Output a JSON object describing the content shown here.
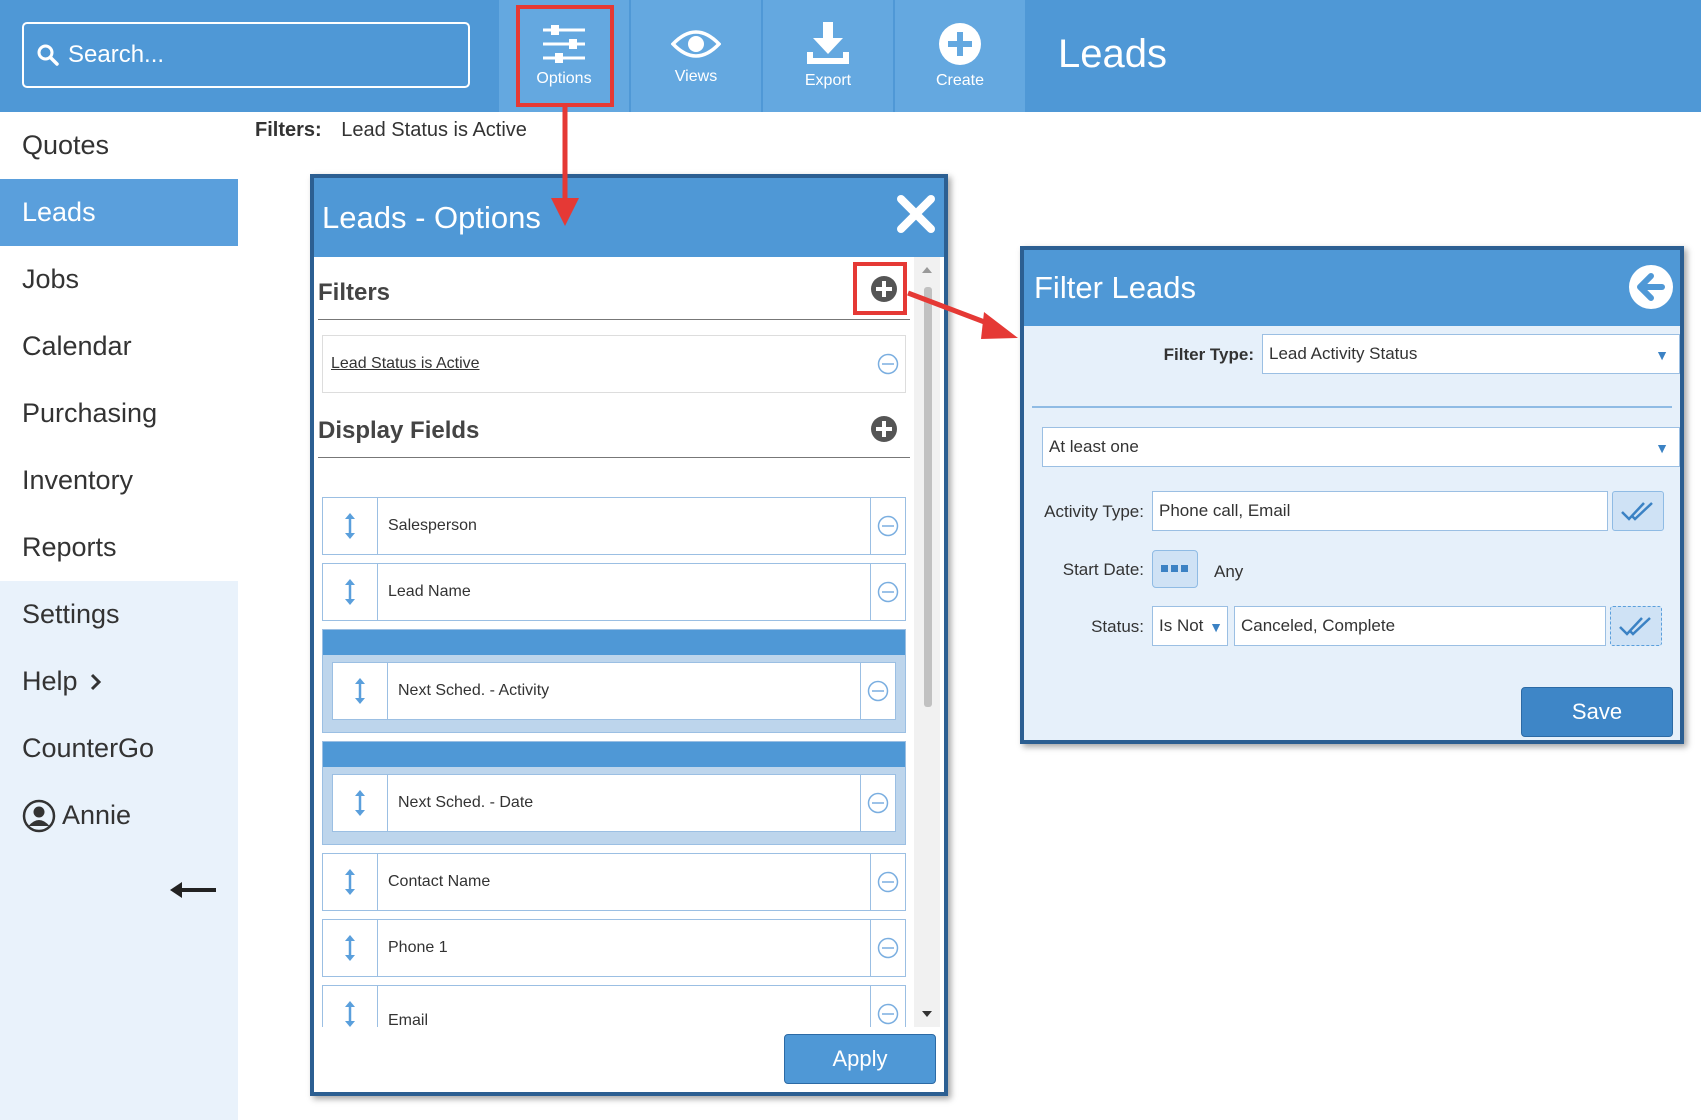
{
  "topbar": {
    "search_placeholder": "Search...",
    "buttons": [
      {
        "label": "Options",
        "icon": "sliders-icon"
      },
      {
        "label": "Views",
        "icon": "eye-icon"
      },
      {
        "label": "Export",
        "icon": "download-icon"
      },
      {
        "label": "Create",
        "icon": "plus-circle-icon"
      }
    ],
    "page_title": "Leads"
  },
  "sidebar": {
    "items": [
      "Quotes",
      "Leads",
      "Jobs",
      "Calendar",
      "Purchasing",
      "Inventory",
      "Reports",
      "Settings",
      "Help",
      "CounterGo"
    ],
    "active": "Leads",
    "user": "Annie"
  },
  "filters_bar": {
    "label": "Filters:",
    "value": "Lead Status is Active"
  },
  "options_dialog": {
    "title": "Leads - Options",
    "filters_title": "Filters",
    "filters": [
      "Lead Status is Active"
    ],
    "display_fields_title": "Display Fields",
    "fields": [
      "Salesperson",
      "Lead Name",
      "Next Sched. - Activity",
      "Next Sched. - Date",
      "Contact Name",
      "Phone 1",
      "Email"
    ],
    "apply_label": "Apply"
  },
  "filter_panel": {
    "title": "Filter Leads",
    "filter_type_label": "Filter Type:",
    "filter_type_value": "Lead Activity Status",
    "match_value": "At least one",
    "activity_type_label": "Activity Type:",
    "activity_type_value": "Phone call, Email",
    "start_date_label": "Start Date:",
    "start_date_value": "Any",
    "status_label": "Status:",
    "status_op": "Is Not",
    "status_value": "Canceled, Complete",
    "save_label": "Save"
  },
  "colors": {
    "brand": "#4f98d6",
    "highlight": "#e53935",
    "dialog_border": "#2c5f92"
  }
}
